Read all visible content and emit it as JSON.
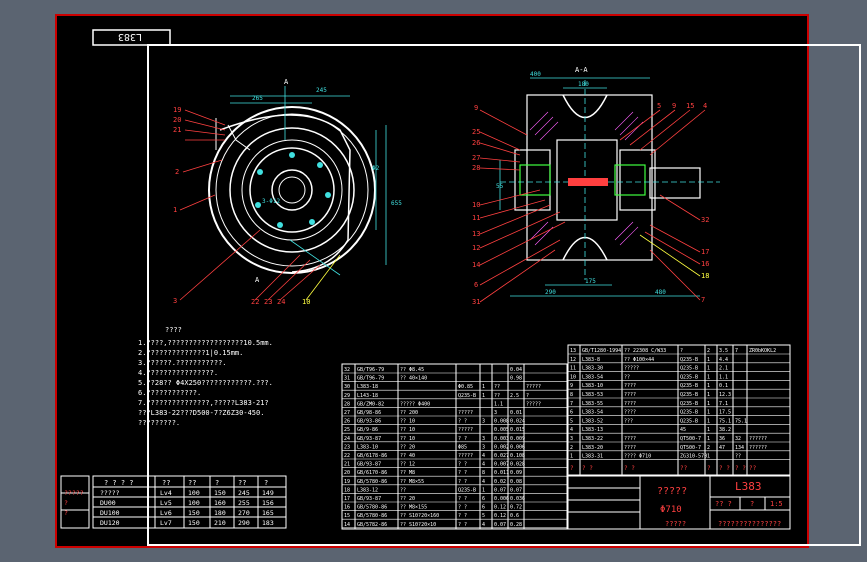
{
  "drawing": {
    "code_box": "L383",
    "section_label": "A-A",
    "section_marks": [
      "A",
      "A"
    ],
    "title_name": "?????",
    "title_spec": "Φ710",
    "title_code": "L383",
    "title_sub": "?????",
    "title_company": "???????????????",
    "title_cells": [
      "?? ?",
      "?",
      "1:5"
    ]
  },
  "notes": {
    "heading": "????",
    "lines": [
      "1.????,??????????????????10.5mm.",
      "2.??????????????1|0.15mm.",
      "3.??????.???????????.",
      "4.????????????????.",
      "5.??28?? Φ4X250????????????.???.",
      "6.????????????.",
      "7.???????????????,?????L383-21?",
      "  ???L383-22???D500-7?Z6Z30-450.",
      "  ?????????."
    ]
  },
  "view_labels_left": [
    "19",
    "20",
    "21",
    "2",
    "1",
    "3",
    "22",
    "23",
    "24",
    "10"
  ],
  "view_labels_right": [
    "9",
    "25",
    "26",
    "27",
    "28",
    "10",
    "11",
    "13",
    "12",
    "14",
    "6",
    "31",
    "5",
    "9",
    "15",
    "4",
    "32",
    "17",
    "16",
    "18",
    "7"
  ],
  "dims_left": [
    "265",
    "245",
    "655",
    "Φ2",
    "3-Φ12"
  ],
  "dims_right": [
    "400",
    "180",
    "175",
    "290",
    "480",
    "55"
  ],
  "spec_table": {
    "headers": [
      "? ? ? ?",
      "??",
      "??",
      "?",
      "??",
      "?"
    ],
    "rows": [
      [
        "?????",
        "?????",
        "Lv4",
        "100",
        "150",
        "245",
        "149"
      ],
      [
        "?",
        "DU00",
        "Lv5",
        "100",
        "160",
        "255",
        "156"
      ],
      [
        "?",
        "DU100",
        "Lv6",
        "150",
        "180",
        "270",
        "165"
      ],
      [
        "",
        "DU120",
        "Lv7",
        "150",
        "210",
        "290",
        "183"
      ]
    ]
  },
  "bom_middle": {
    "rows": [
      [
        "32",
        "GB/T96-79",
        "?? Φ8.45",
        "",
        "",
        "",
        "0.04",
        "",
        ""
      ],
      [
        "31",
        "GB/T96-79",
        "?? 40×140",
        "",
        "",
        "",
        "0.98",
        "",
        ""
      ],
      [
        "30",
        "L383-18",
        "",
        "Φ0.85",
        "1",
        "??",
        "",
        "?????",
        ""
      ],
      [
        "29",
        "L143-18",
        "",
        "Q235-B",
        "1",
        "??",
        "2.5",
        "?",
        ""
      ],
      [
        "28",
        "GB/ZM0-82",
        "?????  Φ400",
        "",
        "",
        "1.1",
        "",
        "?????",
        ""
      ],
      [
        "27",
        "GB/98-86",
        "?? 200",
        "?????",
        "",
        "3",
        "0.01",
        "",
        ""
      ],
      [
        "26",
        "GB/93-86",
        "?? 10",
        "? ?",
        "3",
        "0.008",
        "0.024",
        "",
        ""
      ],
      [
        "25",
        "GB/9-86",
        "?? 10",
        "?????",
        "",
        "0.005",
        "0.015",
        "",
        ""
      ],
      [
        "24",
        "GB/93-87",
        "?? 10",
        "? ?",
        "3",
        "0.003",
        "0.009",
        "",
        ""
      ],
      [
        "23",
        "L383-10",
        "?? 20",
        "Φ85",
        "3",
        "0.002",
        "0.006",
        "",
        ""
      ],
      [
        "22",
        "GB/6178-86",
        "?? 40",
        "?????",
        "4",
        "0.027",
        "0.108",
        "",
        ""
      ],
      [
        "21",
        "GB/93-87",
        "?? 12",
        "? ?",
        "4",
        "0.007",
        "0.028",
        "",
        ""
      ],
      [
        "20",
        "GB/6170-86",
        "?? M8",
        "? ?",
        "8",
        "0.011",
        "0.09",
        "",
        ""
      ],
      [
        "19",
        "GB/5780-86",
        "?? M8×55",
        "? ?",
        "4",
        "0.02",
        "0.08",
        "",
        ""
      ],
      [
        "18",
        "L383-12",
        "??",
        "Q235-B",
        "1",
        "0.07",
        "0.07",
        "",
        ""
      ],
      [
        "17",
        "GB/93-87",
        "?? 20",
        "? ?",
        "6",
        "0.006",
        "0.036",
        "",
        ""
      ],
      [
        "16",
        "GB/5780-86",
        "?? M8×155",
        "? ?",
        "6",
        "0.12",
        "0.72",
        "",
        ""
      ],
      [
        "15",
        "GB/5780-86",
        "?? S10?20×160",
        "? ?",
        "5",
        "0.12",
        "0.6",
        "",
        ""
      ],
      [
        "14",
        "GB/5782-86",
        "?? S10?20×10",
        "? ?",
        "4",
        "0.07",
        "0.28",
        "",
        ""
      ]
    ]
  },
  "bom_right": {
    "rows": [
      [
        "13",
        "GB/T1280-1994",
        "?? 22308 C/W33",
        "?",
        "2",
        "3.5",
        "7",
        "ZR0bKOKL2",
        ""
      ],
      [
        "12",
        "L383-8",
        "?? Φ100×44",
        "Q235-B",
        "1",
        "4.4",
        "",
        "",
        ""
      ],
      [
        "11",
        "L383-30",
        "?????",
        "Q235-B",
        "1",
        "2.1",
        "",
        "",
        ""
      ],
      [
        "10",
        "L383-54",
        "??",
        "Q235-B",
        "1",
        "1.1",
        "",
        "",
        ""
      ],
      [
        "9",
        "L383-10",
        "????",
        "Q235-B",
        "1",
        "0.1",
        "",
        "",
        ""
      ],
      [
        "8",
        "L383-53",
        "????",
        "Q235-B",
        "1",
        "12.3",
        "",
        "",
        ""
      ],
      [
        "7",
        "L383-55",
        "????",
        "Q235-B",
        "1",
        "7.1",
        "",
        "",
        ""
      ],
      [
        "6",
        "L383-54",
        "????",
        "Q235-B",
        "1",
        "17.5",
        "",
        "",
        ""
      ],
      [
        "5",
        "L383-52",
        "???",
        "Q235-B",
        "1",
        "75.1",
        "75.1",
        "",
        ""
      ],
      [
        "4",
        "L383-13",
        "",
        "45",
        "1",
        "38.2",
        "",
        "",
        ""
      ],
      [
        "3",
        "L383-22",
        "????",
        "QT500-7",
        "1",
        "36",
        "32",
        "??????",
        ""
      ],
      [
        "2",
        "L383-20",
        "????",
        "QT500-7",
        "2",
        "47",
        "134",
        "??????",
        ""
      ],
      [
        "1",
        "L383-31",
        "???? Φ710",
        "ZG310-570",
        "1",
        "",
        "??",
        "",
        ""
      ]
    ],
    "header": [
      "?",
      "? ?",
      "? ?",
      "??",
      "?",
      "? ?",
      "? ?",
      "??"
    ]
  },
  "colors": {
    "background": "#5b6471",
    "sheet": "#000000",
    "border": "#cc0000",
    "line": "#ffffff",
    "cyan": "#40e0e0",
    "red": "#ff4040",
    "yellow": "#ffff40",
    "green": "#40ff40"
  }
}
